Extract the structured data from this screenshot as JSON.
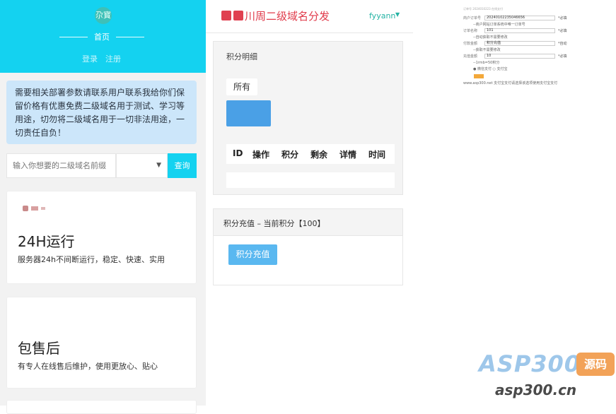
{
  "left": {
    "avatar_text": "尕寳",
    "home_title": "首页",
    "login": "登录",
    "register": "注册",
    "notice": "需要相关部署参数请联系用户联系我给你们保留价格有优惠免费二级域名用于测试、学习等用途，切勿将二级域名用于一切非法用途，一切责任自负！",
    "search": {
      "placeholder": "输入你想要的二级域名前缀",
      "button": "查询"
    },
    "cards": [
      {
        "title": "24H运行",
        "desc": "服务器24h不间断运行，稳定、快速、实用"
      },
      {
        "title": "包售后",
        "desc": "有专人在线售后维护，使用更放心、贴心"
      }
    ]
  },
  "middle": {
    "brand": "川周二级域名分发",
    "user": "fyyann",
    "points": {
      "title": "积分明细",
      "filter_all": "所有",
      "columns": [
        "ID",
        "操作",
        "积分",
        "剩余",
        "详情",
        "时间"
      ]
    },
    "recharge": {
      "title": "积分充值 – 当前积分【100】",
      "button": "积分充值"
    }
  },
  "form": {
    "head": "订单号 2024010223 在线支付",
    "rows": [
      {
        "label": "商户订单号",
        "value": "20240102235046656",
        "req": "*必填"
      },
      {
        "note": "--商户网站订单系统中唯一订单号"
      },
      {
        "label": "订单名称",
        "value": "101",
        "req": "*必填"
      },
      {
        "note": "--自动获取不需要修改"
      },
      {
        "label": "付款金额",
        "value": "积分充值",
        "req": "*自动"
      },
      {
        "note": "--获取不需要修改"
      },
      {
        "label": "充值金额",
        "value": "10",
        "req": "*必填"
      },
      {
        "note": "--1rmb=50积分"
      },
      {
        "note": "● 微信支付 ○ 支付宝"
      }
    ],
    "foot": "www.asp300.net 支付宝支付请选择该选项使用支付宝支付"
  },
  "watermark": {
    "logo": "ASP300",
    "badge": "源码",
    "url": "asp300.cn"
  }
}
